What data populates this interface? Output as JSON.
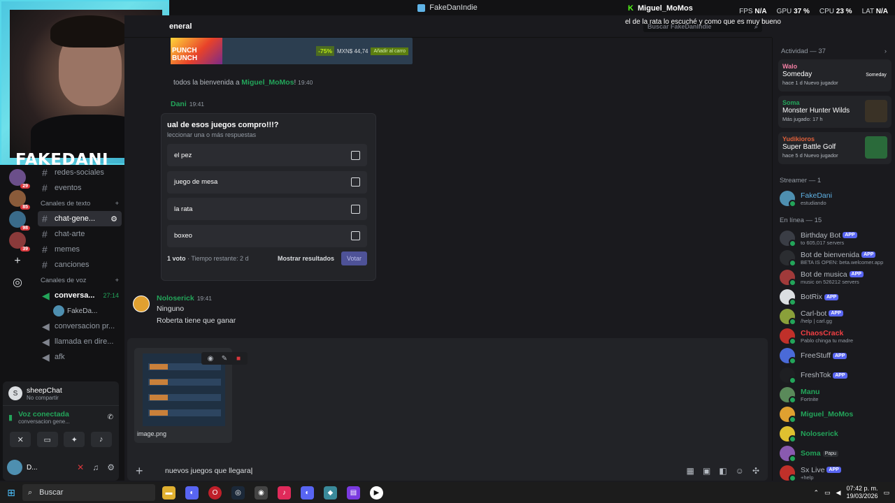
{
  "window": {
    "title": "FakeDanIndie"
  },
  "hud": {
    "fps_label": "FPS",
    "fps": "N/A",
    "gpu_label": "GPU",
    "gpu": "37 %",
    "cpu_label": "CPU",
    "cpu": "23 %",
    "lat_label": "LAT",
    "lat": "N/A"
  },
  "stream_chat": {
    "user": "Miguel_MoMos",
    "message": "el de la rata lo escuché y como que es muy bueno"
  },
  "webcam": {
    "name": "FAKEDANI"
  },
  "servers": [
    {
      "badge": "29",
      "color": "#6b4f8a"
    },
    {
      "badge": "85",
      "color": "#8a5b3a"
    },
    {
      "badge": "98",
      "color": "#3a6b8a"
    },
    {
      "badge": "39",
      "color": "#8a3a3a"
    }
  ],
  "channels": {
    "top": [
      {
        "name": "redes-sociales"
      },
      {
        "name": "eventos"
      }
    ],
    "text_category": "Canales de texto",
    "text": [
      {
        "name": "chat-gene...",
        "active": true
      },
      {
        "name": "chat-arte"
      },
      {
        "name": "memes"
      },
      {
        "name": "canciones"
      }
    ],
    "voice_category": "Canales de voz",
    "voice_active": {
      "name": "conversa...",
      "time": "27:14",
      "user": "FakeDa..."
    },
    "voice": [
      {
        "name": "conversacion pr..."
      },
      {
        "name": "llamada en dire..."
      },
      {
        "name": "afk"
      }
    ]
  },
  "now_playing": {
    "title": "sheepChat",
    "sub": "No compartir"
  },
  "voice_connected": {
    "title": "Voz conectada",
    "sub": "conversacion gene..."
  },
  "user_bar": {
    "name": "D..."
  },
  "chat": {
    "channel": "eneral",
    "search_placeholder": "Buscar FakeDanIndie",
    "banner": {
      "game": "PUNCH BUNCH",
      "discount": "-75%",
      "price": "MXN$ 44,74",
      "cart": "Añadir al carro"
    },
    "system": {
      "prefix": "todos la bienvenida a ",
      "user": "Miguel_MoMos",
      "suffix": "!",
      "time": "19:40"
    },
    "poll_author": {
      "name": "Dani",
      "time": "19:41"
    },
    "poll": {
      "question": "ual de esos juegos compro!!!?",
      "hint": "leccionar una o más respuestas",
      "options": [
        "el pez",
        "juego de mesa",
        "la rata",
        "boxeo"
      ],
      "votes": "1 voto",
      "remaining": "Tiempo restante: 2 d",
      "show_results": "Mostrar resultados",
      "vote": "Votar"
    },
    "message": {
      "author": "Noloserick",
      "time": "19:41",
      "lines": [
        "Ninguno",
        "Roberta tiene que ganar"
      ]
    },
    "attachment": {
      "filename": "image.png"
    },
    "input": "nuevos juegos que llegara"
  },
  "members": {
    "activity_header": "Actividad — 37",
    "activities": [
      {
        "user": "Walo",
        "user_color": "#f47fa4",
        "game": "Someday",
        "meta1": "hace 1 d",
        "meta2": "Nuevo jugador",
        "art": "Someday",
        "art_bg": "#232428"
      },
      {
        "user": "Soma",
        "user_color": "#23a55a",
        "game": "Monster Hunter Wilds",
        "meta1": "Más jugado: 17 h",
        "meta2": "",
        "art": "",
        "art_bg": "#3a3226"
      },
      {
        "user": "Yudikioros",
        "user_color": "#e0603a",
        "game": "Super Battle Golf",
        "meta1": "hace 5 d",
        "meta2": "Nuevo jugador",
        "art": "",
        "art_bg": "#2a6a3a"
      }
    ],
    "streamer_header": "Streamer — 1",
    "streamer": {
      "name": "FakeDani",
      "status": "estudiando"
    },
    "online_header": "En línea — 15",
    "online": [
      {
        "name": "Birthday Bot",
        "app": "APP",
        "sub": "to 605,017 servers",
        "color": "#3a3d45"
      },
      {
        "name": "Bot de bienvenida",
        "app": "APP",
        "sub": "BETA IS OPEN: beta.welcomer.app",
        "color": "#2b2d31"
      },
      {
        "name": "Bot de musica",
        "app": "APP",
        "sub": "music on 526212 servers",
        "color": "#a03a3a"
      },
      {
        "name": "BotRix",
        "app": "APP",
        "sub": "",
        "color": "#dbdee1"
      },
      {
        "name": "Carl-bot",
        "app": "APP",
        "sub": "/help | carl.gg",
        "color": "#8aa03a"
      },
      {
        "name": "ChaosCrack",
        "app": "",
        "sub": "Pablo chinga tu madre",
        "color": "#c0302a",
        "name_color": "#f23f43"
      },
      {
        "name": "FreeStuff",
        "app": "APP",
        "sub": "",
        "color": "#4a6ad8"
      },
      {
        "name": "FreshTok",
        "app": "APP",
        "sub": "",
        "color": "#1e1f22"
      },
      {
        "name": "Manu",
        "app": "",
        "sub": "Fortnite",
        "color": "#5a8a5a",
        "name_color": "#23a55a"
      },
      {
        "name": "Miguel_MoMos",
        "app": "",
        "sub": "",
        "color": "#e0a030",
        "name_color": "#23a55a"
      },
      {
        "name": "Noloserick",
        "app": "",
        "sub": "",
        "color": "#e0c030",
        "name_color": "#23a55a"
      },
      {
        "name": "Soma",
        "app": "",
        "tag": "Papu",
        "sub": "",
        "color": "#8a5ab0",
        "name_color": "#23a55a"
      },
      {
        "name": "Sx Live",
        "app": "APP",
        "sub": "+help",
        "color": "#c0302a"
      }
    ]
  },
  "taskbar": {
    "search": "Buscar",
    "time": "07:42 p. m.",
    "date": "19/03/2026"
  }
}
